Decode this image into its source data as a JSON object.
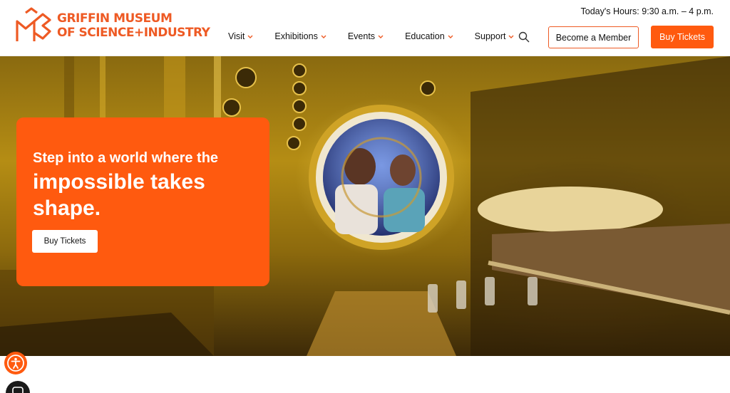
{
  "brand": {
    "line1": "Griffin Museum",
    "line2": "of Science+Industry",
    "color": "#ee5a24"
  },
  "header": {
    "hours": "Today's Hours: 9:30 a.m. – 4 p.m.",
    "nav": [
      {
        "label": "Visit"
      },
      {
        "label": "Exhibitions"
      },
      {
        "label": "Events"
      },
      {
        "label": "Education"
      },
      {
        "label": "Support"
      }
    ],
    "member_label": "Become a Member",
    "tickets_label": "Buy Tickets"
  },
  "hero": {
    "tagline_small": "Step into a world where the",
    "tagline_big": "impossible takes shape.",
    "cta_label": "Buy Tickets",
    "accent": "#ff5a0f"
  },
  "icons": {
    "search": "search-icon",
    "accessibility": "accessibility-icon",
    "chat": "chat-icon"
  }
}
